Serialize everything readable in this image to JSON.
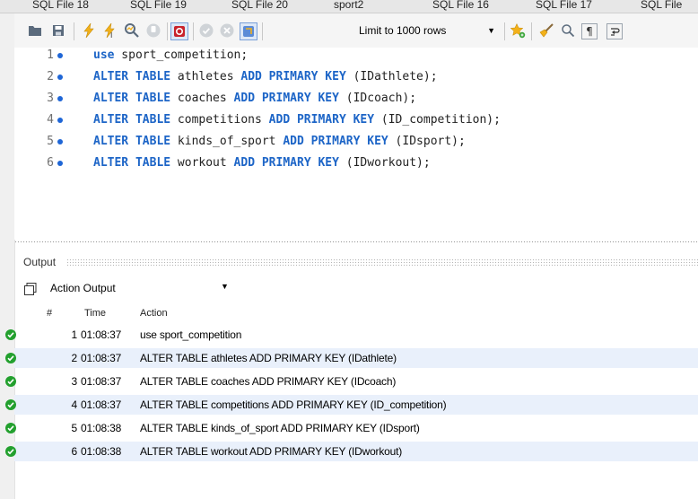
{
  "tabs": [
    "SQL File 18",
    "SQL File 19",
    "SQL File 20",
    "sport2",
    "SQL File 16",
    "SQL File 17",
    "SQL File"
  ],
  "toolbar": {
    "icons": [
      "folder-icon",
      "save-icon",
      "execute-icon",
      "execute-current-icon",
      "explain-icon",
      "stop-icon",
      "toggle-error-icon",
      "commit-icon",
      "rollback-icon",
      "autocommit-icon",
      "bookmark-icon",
      "beautify-icon",
      "find-icon",
      "invisible-chars-icon",
      "wrap-icon"
    ],
    "limit_label": "Limit to 1000 rows"
  },
  "editor": {
    "lines": [
      {
        "num": "1",
        "parts": [
          {
            "t": "use",
            "kw": true
          },
          {
            "t": " sport_competition;",
            "kw": false
          }
        ]
      },
      {
        "num": "2",
        "parts": [
          {
            "t": "ALTER TABLE",
            "kw": true
          },
          {
            "t": " athletes ",
            "kw": false
          },
          {
            "t": "ADD PRIMARY KEY",
            "kw": true
          },
          {
            "t": " (IDathlete);",
            "kw": false
          }
        ]
      },
      {
        "num": "3",
        "parts": [
          {
            "t": "ALTER TABLE",
            "kw": true
          },
          {
            "t": " coaches ",
            "kw": false
          },
          {
            "t": "ADD PRIMARY KEY",
            "kw": true
          },
          {
            "t": " (IDcoach);",
            "kw": false
          }
        ]
      },
      {
        "num": "4",
        "parts": [
          {
            "t": "ALTER TABLE",
            "kw": true
          },
          {
            "t": " competitions ",
            "kw": false
          },
          {
            "t": "ADD PRIMARY KEY",
            "kw": true
          },
          {
            "t": " (ID_competition);",
            "kw": false
          }
        ]
      },
      {
        "num": "5",
        "parts": [
          {
            "t": "ALTER TABLE",
            "kw": true
          },
          {
            "t": " kinds_of_sport ",
            "kw": false
          },
          {
            "t": "ADD PRIMARY KEY",
            "kw": true
          },
          {
            "t": " (IDsport);",
            "kw": false
          }
        ]
      },
      {
        "num": "6",
        "parts": [
          {
            "t": "ALTER TABLE",
            "kw": true
          },
          {
            "t": " workout ",
            "kw": false
          },
          {
            "t": "ADD PRIMARY KEY",
            "kw": true
          },
          {
            "t": " (IDworkout);",
            "kw": false
          }
        ]
      }
    ]
  },
  "output": {
    "title": "Output",
    "selector": "Action Output",
    "columns": {
      "num": "#",
      "time": "Time",
      "action": "Action"
    },
    "rows": [
      {
        "num": "1",
        "time": "01:08:37",
        "action": "use sport_competition"
      },
      {
        "num": "2",
        "time": "01:08:37",
        "action": "ALTER TABLE athletes ADD PRIMARY KEY (IDathlete)"
      },
      {
        "num": "3",
        "time": "01:08:37",
        "action": "ALTER TABLE coaches ADD PRIMARY KEY (IDcoach)"
      },
      {
        "num": "4",
        "time": "01:08:37",
        "action": "ALTER TABLE competitions ADD PRIMARY KEY (ID_competition)"
      },
      {
        "num": "5",
        "time": "01:08:38",
        "action": "ALTER TABLE kinds_of_sport ADD PRIMARY KEY (IDsport)"
      },
      {
        "num": "6",
        "time": "01:08:38",
        "action": "ALTER TABLE workout ADD PRIMARY KEY (IDworkout)"
      }
    ]
  },
  "colors": {
    "keyword": "#1d65c7",
    "success": "#23a02e",
    "row_alt": "#e9f0fb"
  }
}
